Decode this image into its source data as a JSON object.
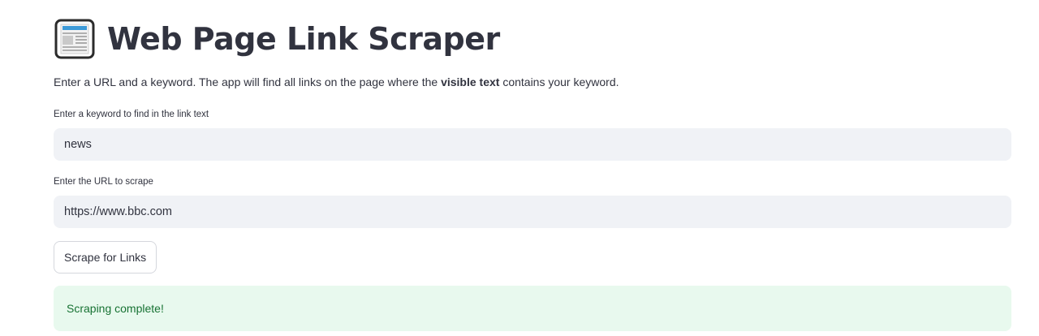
{
  "header": {
    "title": "Web Page Link Scraper",
    "icon": "newspaper-icon"
  },
  "intro": {
    "prefix": "Enter a URL and a keyword. The app will find all links on the page where the ",
    "bold": "visible text",
    "suffix": " contains your keyword."
  },
  "keyword_field": {
    "label": "Enter a keyword to find in the link text",
    "value": "news"
  },
  "url_field": {
    "label": "Enter the URL to scrape",
    "value": "https://www.bbc.com"
  },
  "actions": {
    "scrape_label": "Scrape for Links"
  },
  "status": {
    "message": "Scraping complete!",
    "color": "#177233",
    "background": "#e8f9ee"
  }
}
